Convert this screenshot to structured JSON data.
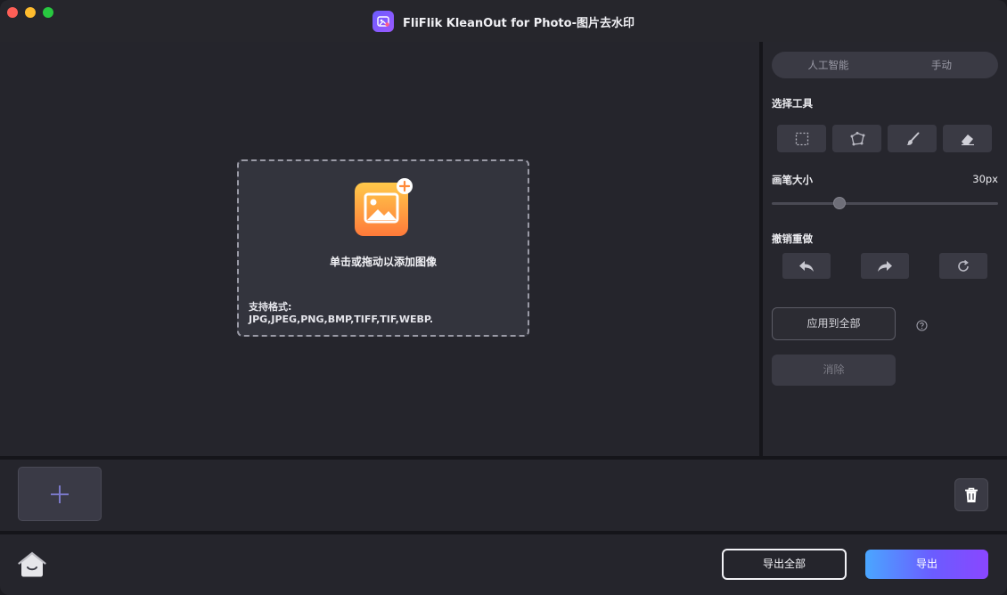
{
  "window": {
    "title": "FliFlik KleanOut for Photo-图片去水印"
  },
  "canvas": {
    "dropzone": {
      "prompt": "单击或拖动以添加图像",
      "formats_label": "支持格式:",
      "formats_value": "JPG,JPEG,PNG,BMP,TIFF,TIF,WEBP."
    }
  },
  "panel": {
    "mode_tabs": [
      {
        "label": "人工智能"
      },
      {
        "label": "手动"
      }
    ],
    "select_tool_label": "选择工具",
    "tools": [
      "rect-select-icon",
      "lasso-icon",
      "brush-icon",
      "eraser-icon"
    ],
    "brush_size_label": "画笔大小",
    "brush_size_value": "30px",
    "brush_size_level": 0.3,
    "undo_redo_label": "撤销重做",
    "apply_all_label": "应用到全部",
    "erase_label": "消除"
  },
  "footer": {
    "export_all_label": "导出全部",
    "export_label": "导出"
  },
  "colors": {
    "accent_gradient_start": "#4aa6ff",
    "accent_gradient_end": "#8a46ff"
  }
}
